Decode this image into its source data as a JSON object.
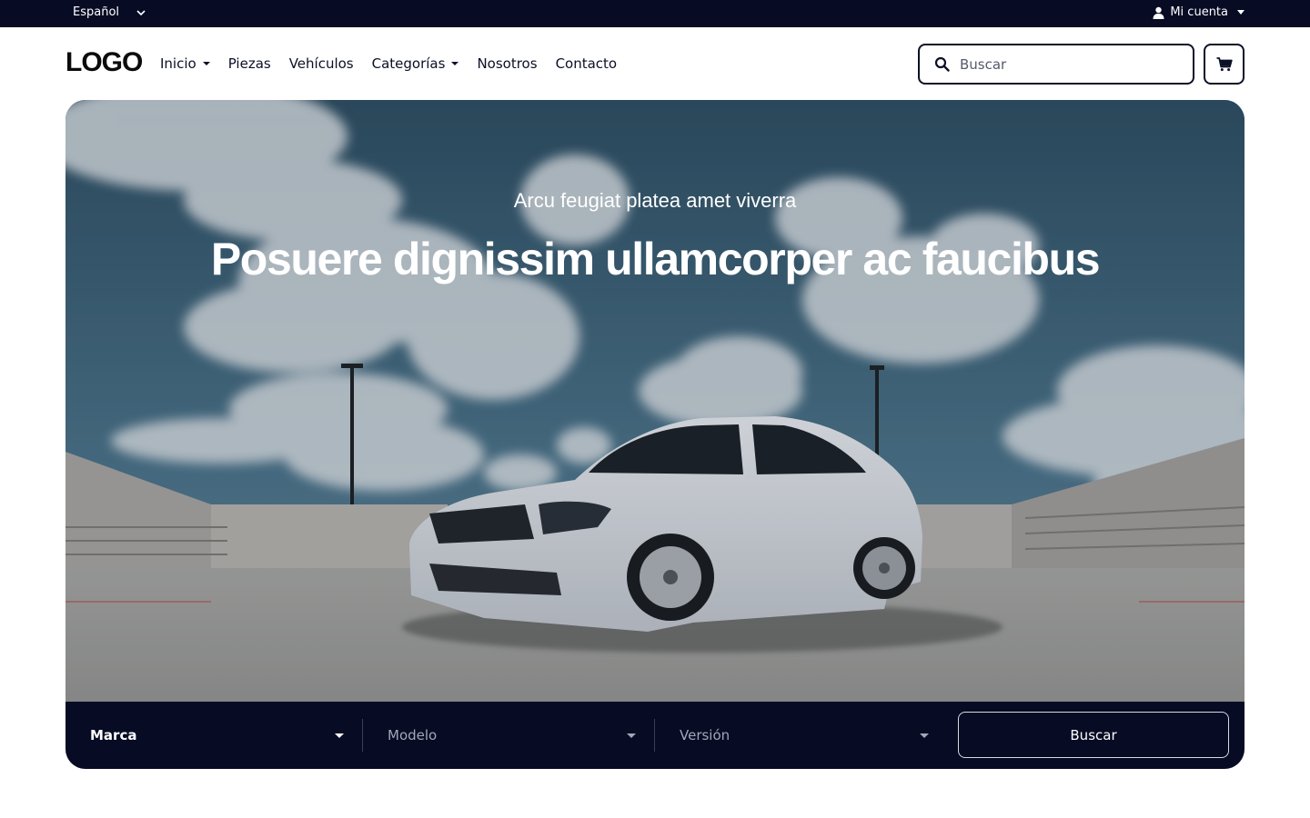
{
  "topbar": {
    "language": "Español",
    "account": "Mi cuenta"
  },
  "header": {
    "logo": "LOGO",
    "nav": [
      {
        "label": "Inicio",
        "dropdown": true
      },
      {
        "label": "Piezas",
        "dropdown": false
      },
      {
        "label": "Vehículos",
        "dropdown": false
      },
      {
        "label": "Categorías",
        "dropdown": true
      },
      {
        "label": "Nosotros",
        "dropdown": false
      },
      {
        "label": "Contacto",
        "dropdown": false
      }
    ],
    "search_placeholder": "Buscar",
    "search_value": ""
  },
  "hero": {
    "subtitle": "Arcu feugiat platea amet viverra",
    "title": "Posuere dignissim ullamcorper ac faucibus"
  },
  "filters": {
    "brand": "Marca",
    "model": "Modelo",
    "version": "Versión",
    "submit": "Buscar"
  },
  "colors": {
    "navy": "#070b24",
    "text": "#0b1026",
    "muted": "#a3a7b7"
  }
}
